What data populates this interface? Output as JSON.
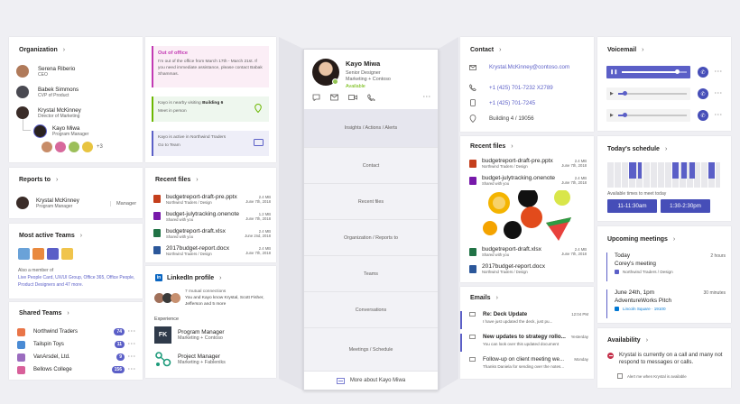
{
  "left": {
    "org": {
      "title": "Organization",
      "people": [
        {
          "name": "Serena Riberio",
          "role": "CEO"
        },
        {
          "name": "Babek Simmons",
          "role": "CVP of Product"
        },
        {
          "name": "Krystal McKinney",
          "role": "Director of Marketing"
        },
        {
          "name": "Kayo Miwa",
          "role": "Program Manager"
        }
      ],
      "more": "+3"
    },
    "reports": {
      "title": "Reports to",
      "name": "Krystal McKinney",
      "role": "Program Manager",
      "tag": "Manager"
    },
    "teams": {
      "title": "Most active Teams",
      "member_prefix": "Also a member of",
      "member_links": "Live People Card, UX/UI Group, Office 365, Office People, Product Designers",
      "member_more": "and 47 more."
    },
    "shared": {
      "title": "Shared Teams",
      "items": [
        {
          "name": "Northwind Traders",
          "count": "74",
          "color": "#e97548"
        },
        {
          "name": "Tailspin Toys",
          "count": "11",
          "color": "#4a8bd4"
        },
        {
          "name": "VanArsdel, Ltd.",
          "count": "9",
          "color": "#9b6cbf"
        },
        {
          "name": "Bellows College",
          "count": "156",
          "color": "#d8609a"
        }
      ]
    }
  },
  "mid": {
    "ooo": {
      "title": "Out of office",
      "text": "I'm out of the office from March 17th - March 21st. If you need immediate assistance, please contact Babak Shammas."
    },
    "visiting": {
      "prefix": "Kayo is nearby visiting",
      "place": "Building 6",
      "action": "Meet in person"
    },
    "active": {
      "text": "Kayo is active in Northwind Traders",
      "action": "Go to Team"
    },
    "files": {
      "title": "Recent files",
      "items": [
        {
          "name": "budgetreport-draft-pre.pptx",
          "sub": "Northwind Traders / Design",
          "size": "2.4 MB",
          "date": "June 7th, 2018",
          "color": "#c43e1c"
        },
        {
          "name": "budget-julytracking.onenote",
          "sub": "Shared with you",
          "size": "1.2 MB",
          "date": "June 7th, 2018",
          "color": "#7719aa"
        },
        {
          "name": "budgetreport-draft.xlsx",
          "sub": "Shared with you",
          "size": "2.4 MB",
          "date": "June 2nd, 2018",
          "color": "#217346"
        },
        {
          "name": "2017budget-report.docx",
          "sub": "Northwind Traders / Design",
          "size": "2.4 MB",
          "date": "June 7th, 2018",
          "color": "#2b579a"
        }
      ]
    },
    "linkedin": {
      "title": "LinkedIn profile",
      "connections": "7 mutual connections",
      "text": "You and Kayo know Krystal, Scott Fisher, Jefferson and 5 more",
      "exp_title": "Experience",
      "jobs": [
        {
          "title": "Program Manager",
          "org": "Marketing + Contoso"
        },
        {
          "title": "Project Manager",
          "org": "Marketing + Fableniks"
        }
      ]
    }
  },
  "center": {
    "name": "Kayo Miwa",
    "title": "Senior Designer",
    "dept": "Marketing + Contoso",
    "status": "Available",
    "sections": [
      "Insights / Actions / Alerts",
      "Contact",
      "Recent files",
      "Organization / Reports to",
      "Teams",
      "Conversations",
      "Meetings / Schedule"
    ],
    "more": "More about Kayo Miwa"
  },
  "right": {
    "contact": {
      "title": "Contact",
      "email": "Krystal.McKinney@contoso.com",
      "phone1": "+1 (425) 701-7232 X2789",
      "phone2": "+1 (425) 701-7245",
      "office": "Building 4 / 19056"
    },
    "files": {
      "title": "Recent files",
      "items": [
        {
          "name": "budgetreport-draft-pre.pptx",
          "sub": "Northwind Traders / Design",
          "size": "2.4 MB",
          "date": "June 7th, 2018",
          "color": "#c43e1c"
        },
        {
          "name": "budget-julytracking.onenote",
          "sub": "Shared with you",
          "size": "2.4 MB",
          "date": "June 7th, 2018",
          "color": "#7719aa"
        },
        {
          "name": "budgetreport-draft.xlsx",
          "sub": "Shared with you",
          "size": "2.4 MB",
          "date": "June 7th, 2018",
          "color": "#217346"
        },
        {
          "name": "2017budget-report.docx",
          "sub": "Northwind Traders / Design",
          "size": "",
          "date": "",
          "color": "#2b579a"
        }
      ]
    },
    "emails": {
      "title": "Emails",
      "items": [
        {
          "subject": "Re: Deck Update",
          "time": "12:04 PM",
          "preview": "I have just updated the deck, just pu..."
        },
        {
          "subject": "New updates to strategy rollo...",
          "time": "Yesterday",
          "preview": "You can look over this updated document"
        },
        {
          "subject": "Follow-up on client meeting we...",
          "time": "Monday",
          "preview": "Thanks Daniela for sending over the notes..."
        }
      ]
    }
  },
  "far": {
    "voicemail": {
      "title": "Voicemail",
      "items": [
        {
          "progress": 0.85,
          "active": true
        },
        {
          "progress": 0.1,
          "active": false
        },
        {
          "progress": 0.1,
          "active": false
        }
      ]
    },
    "schedule": {
      "title": "Today's schedule",
      "free_label": "Available times to meet today",
      "slots": [
        "11-11:30am",
        "1:30-2:30pm"
      ]
    },
    "meetings": {
      "title": "Upcoming meetings",
      "items": [
        {
          "when": "Today",
          "time": "2 hours",
          "title": "Corey's meeting",
          "loc": "Northwind Traders / Design"
        },
        {
          "when": "June 24th, 1pm",
          "time": "30 minutes",
          "title": "AdventureWorks Pitch",
          "loc": "Lincoln Square · 19100"
        }
      ]
    },
    "availability": {
      "title": "Availability",
      "text": "Krystal is currently on a call and many not respond to messages or calls.",
      "alert": "Alert me when Krystal is available"
    }
  }
}
